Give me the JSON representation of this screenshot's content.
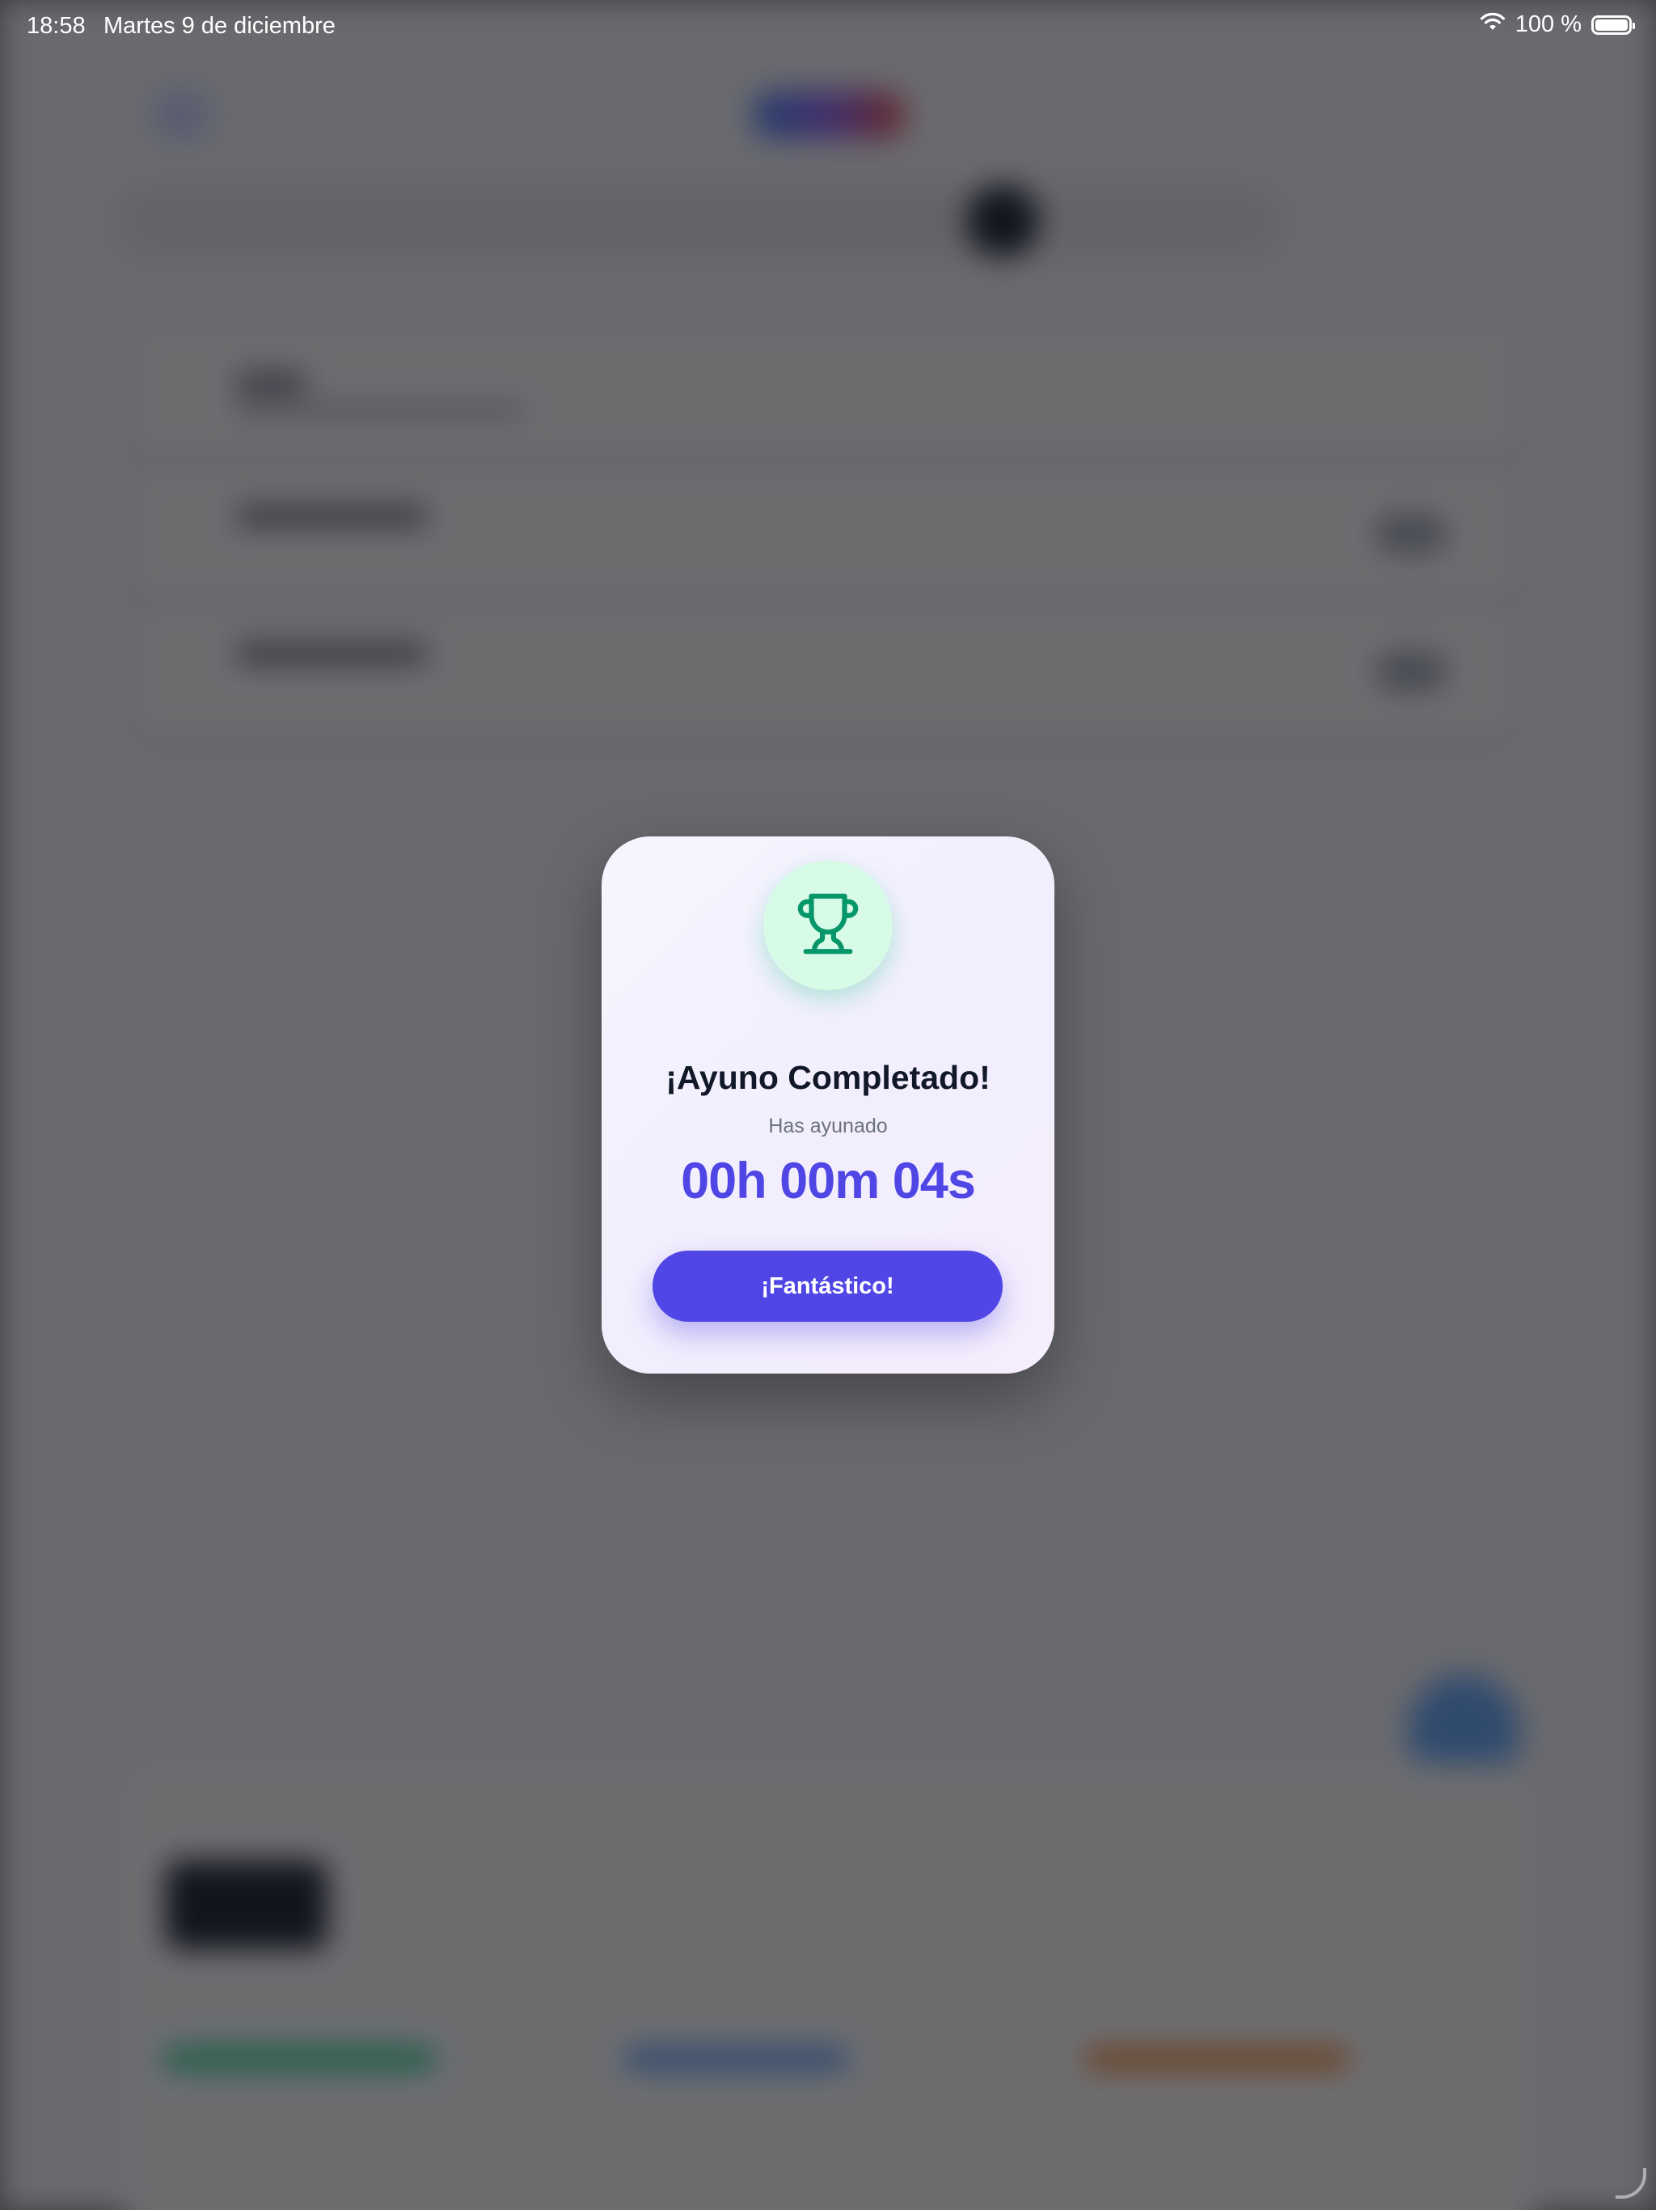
{
  "status_bar": {
    "time": "18:58",
    "date": "Martes 9 de diciembre",
    "battery": "100 %",
    "icons": [
      "wifi-icon",
      "battery-icon"
    ]
  },
  "modal": {
    "icon": "trophy-icon",
    "title": "¡Ayuno Completado!",
    "subtitle": "Has ayunado",
    "duration": "00h 00m 04s",
    "button_label": "¡Fantástico!"
  },
  "colors": {
    "accent": "#4f46e5",
    "trophy": "#059669",
    "trophy_bg": "#d8fbe8",
    "title": "#111827",
    "subtitle": "#6b7280"
  }
}
